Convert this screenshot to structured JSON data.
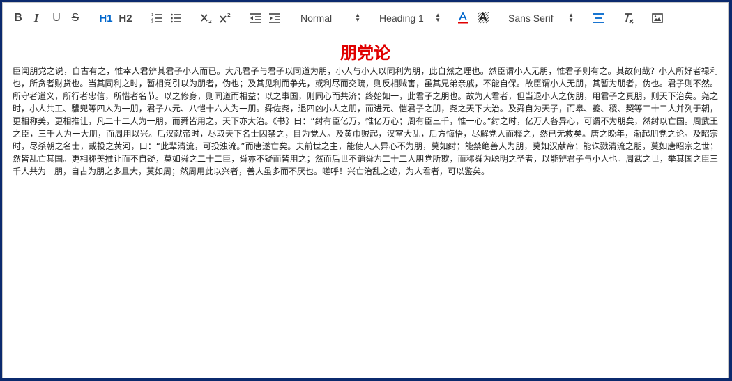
{
  "toolbar": {
    "bold_label": "B",
    "italic_label": "I",
    "underline_label": "U",
    "strike_label": "S",
    "h1_label": "H1",
    "h2_label": "H2",
    "paragraph_style": "Normal",
    "heading_style": "Heading 1",
    "font_family": "Sans Serif",
    "colors": {
      "icon": "#444444",
      "active": "#0066cc",
      "text_color_underline": "#e00000"
    }
  },
  "document": {
    "title": "朋党论",
    "title_color": "#e00000",
    "body": "臣闻朋党之说，自古有之，惟幸人君辨其君子小人而已。大凡君子与君子以同道为朋，小人与小人以同利为朋，此自然之理也。然臣谓小人无朋，惟君子则有之。其故何哉？小人所好者禄利也，所贪者财货也。当其同利之时，暂相党引以为朋者，伪也；及其见利而争先，或利尽而交疏，则反相贼害，虽其兄弟亲戚，不能自保。故臣谓小人无朋，其暂为朋者，伪也。君子则不然。所守者道义，所行者忠信，所惜者名节。以之修身，则同道而相益；以之事国，则同心而共济；终始如一，此君子之朋也。故为人君者，但当退小人之伪朋，用君子之真朋，则天下治矣。尧之时，小人共工、驩兜等四人为一朋，君子八元、八恺十六人为一朋。舜佐尧，退四凶小人之朋，而进元、恺君子之朋，尧之天下大治。及舜自为天子，而皋、夔、稷、契等二十二人并列于朝，更相称美，更相推让，凡二十二人为一朋，而舜皆用之，天下亦大治。《书》曰：“纣有臣亿万，惟亿万心；周有臣三千，惟一心。”纣之时，亿万人各异心，可谓不为朋矣，然纣以亡国。周武王之臣，三千人为一大朋，而周用以兴。后汉献帝时，尽取天下名士囚禁之，目为党人。及黄巾贼起，汉室大乱，后方悔悟，尽解党人而释之，然已无救矣。唐之晚年，渐起朋党之论。及昭宗时，尽杀朝之名士，或投之黄河，曰：“此辈清流，可投浊流。”而唐遂亡矣。夫前世之主，能使人人异心不为朋，莫如纣；能禁绝善人为朋，莫如汉献帝；能诛戮清流之朋，莫如唐昭宗之世；然皆乱亡其国。更相称美推让而不自疑，莫如舜之二十二臣，舜亦不疑而皆用之；然而后世不诮舜为二十二人朋党所欺，而称舜为聪明之圣者，以能辨君子与小人也。周武之世，举其国之臣三千人共为一朋，自古为朋之多且大，莫如周；然周用此以兴者，善人虽多而不厌也。嗟呼！兴亡治乱之迹，为人君者，可以鉴矣。"
  }
}
